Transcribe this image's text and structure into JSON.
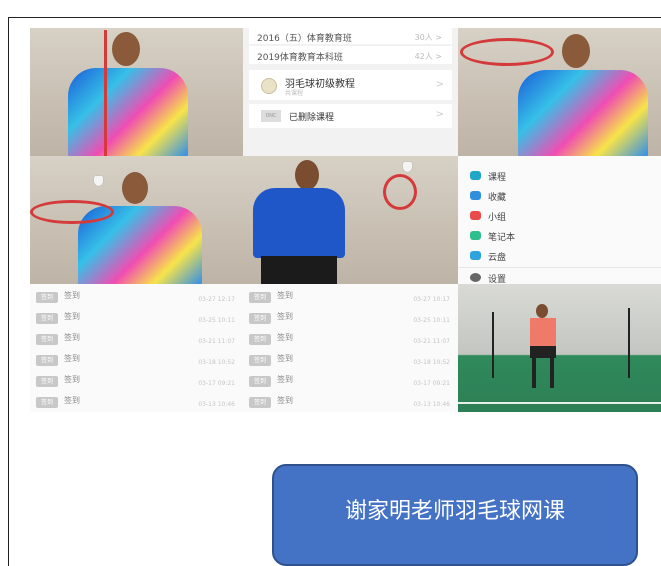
{
  "applist": {
    "rows": [
      {
        "title": "2016（五）体育教育班",
        "right": "30人 >"
      },
      {
        "title": "2019体育教育本科班",
        "right": "42人 >"
      }
    ],
    "course": {
      "title": "羽毛球初级教程",
      "sub": "共课程",
      "chevron": ">"
    },
    "deleted": {
      "icon_label": "DNC",
      "title": "已删除课程",
      "chevron": ">"
    }
  },
  "menu": {
    "items": [
      {
        "label": "课程",
        "icon": "graduation-cap-icon",
        "color": "#1ea7c9"
      },
      {
        "label": "收藏",
        "icon": "star-icon",
        "color": "#2f8fdd"
      },
      {
        "label": "小组",
        "icon": "group-icon",
        "color": "#e94b4b"
      },
      {
        "label": "笔记本",
        "icon": "notebook-icon",
        "color": "#2fbf8f"
      },
      {
        "label": "云盘",
        "icon": "cloud-icon",
        "color": "#2fa3e0"
      },
      {
        "label": "设置",
        "icon": "gear-icon",
        "color": "#666666"
      }
    ]
  },
  "signin_left": {
    "rows": [
      {
        "badge": "签到",
        "label": "签到",
        "time": "03-27 12:17"
      },
      {
        "badge": "签到",
        "label": "签到",
        "time": "03-25 10:11"
      },
      {
        "badge": "签到",
        "label": "签到",
        "time": "03-21 11:07"
      },
      {
        "badge": "签到",
        "label": "签到",
        "time": "03-18 10:52"
      },
      {
        "badge": "签到",
        "label": "签到",
        "time": "03-17 09:21"
      },
      {
        "badge": "签到",
        "label": "签到",
        "time": "03-13 10:46"
      }
    ]
  },
  "signin_right": {
    "rows": [
      {
        "badge": "签到",
        "label": "签到",
        "time": "03-27 10:17"
      },
      {
        "badge": "签到",
        "label": "签到",
        "time": "03-25 10:11"
      },
      {
        "badge": "签到",
        "label": "签到",
        "time": "03-21 11:07"
      },
      {
        "badge": "签到",
        "label": "签到",
        "time": "03-18 10:52"
      },
      {
        "badge": "签到",
        "label": "签到",
        "time": "03-17 09:21"
      },
      {
        "badge": "签到",
        "label": "签到",
        "time": "03-13 10:46"
      }
    ]
  },
  "caption": {
    "text": "谢家明老师羽毛球网课"
  }
}
